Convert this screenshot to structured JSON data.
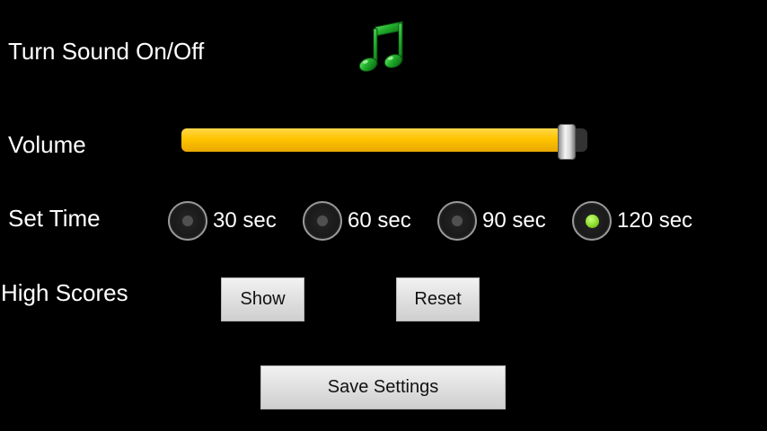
{
  "settings": {
    "sound_label": "Turn Sound On/Off",
    "sound_icon": "music-note-icon",
    "sound_on": true,
    "volume_label": "Volume",
    "volume_fraction": 0.97,
    "time_label": "Set Time",
    "time_options": [
      {
        "label": "30 sec",
        "checked": false
      },
      {
        "label": "60 sec",
        "checked": false
      },
      {
        "label": "90 sec",
        "checked": false
      },
      {
        "label": "120 sec",
        "checked": true
      }
    ],
    "scores_label": "High Scores",
    "show_button": "Show",
    "reset_button": "Reset",
    "save_button": "Save Settings"
  },
  "colors": {
    "background": "#000000",
    "slider_fill": "#ffc400",
    "radio_checked": "#8ad92a",
    "music_icon": "#1fae2a"
  }
}
